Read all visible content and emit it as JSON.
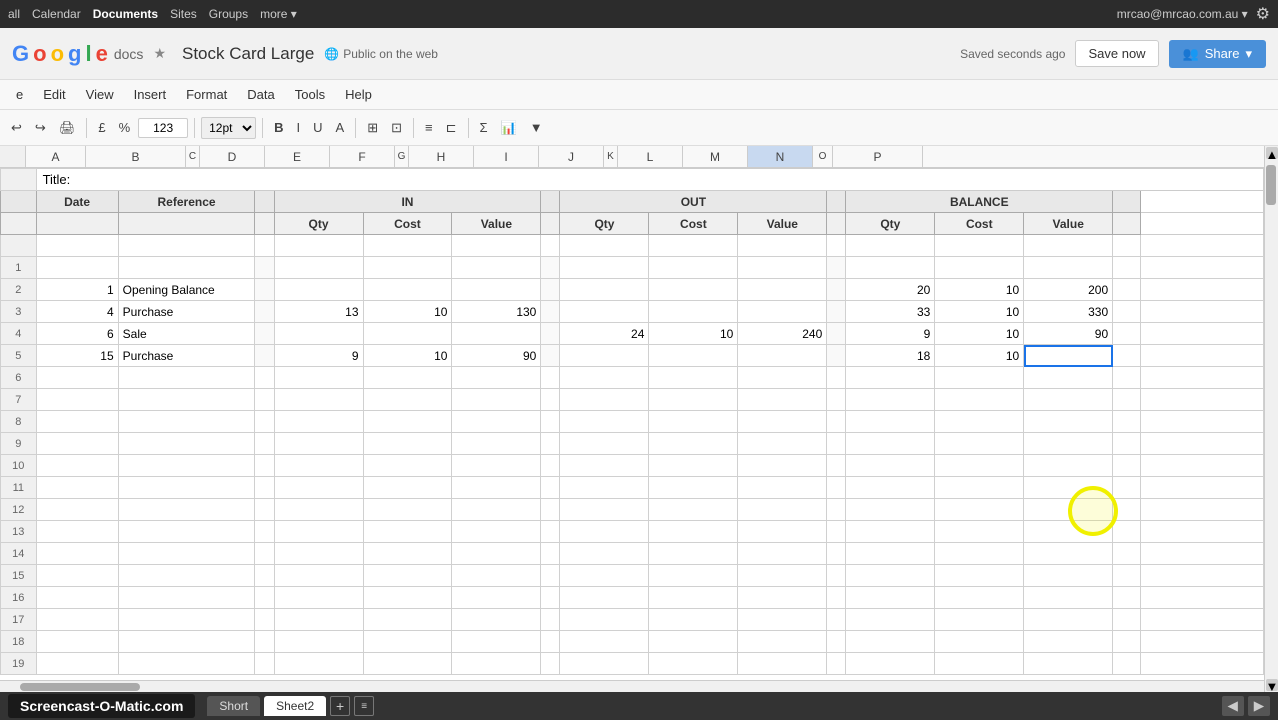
{
  "topBar": {
    "leftItems": [
      "all",
      "Calendar",
      "Documents",
      "Sites",
      "Groups",
      "more ▾"
    ],
    "rightText": "mrcao@mrcao.com.au ▾",
    "gearTitle": "Settings"
  },
  "appHeader": {
    "logoText": "Google docs",
    "starSymbol": "★",
    "docTitle": "Stock Card Large",
    "globeSymbol": "🌐",
    "publicLabel": "Public on the web",
    "savedText": "Saved seconds ago",
    "saveNowLabel": "Save now",
    "shareLabel": "Share",
    "shareDropdown": "▾"
  },
  "menuBar": {
    "items": [
      "e",
      "Edit",
      "View",
      "Insert",
      "Format",
      "Data",
      "Tools",
      "Help"
    ]
  },
  "toolbar": {
    "undoLabel": "↩",
    "redoLabel": "↪",
    "printLabel": "🖨",
    "percentLabel": "%",
    "currencyLabel": "£",
    "zoomValue": "123",
    "fontSizeValue": "12pt",
    "boldLabel": "B",
    "italicLabel": "I",
    "underlineLabel": "U",
    "fontColorLabel": "A",
    "bgColorLabel": "A",
    "bordersLabel": "⊞",
    "mergeLabel": "⊡",
    "alignLabel": "≡",
    "wrapLabel": "⊏",
    "clipLabel": "⊏",
    "formulaLabel": "Σ",
    "chartLabel": "📊",
    "filterLabel": "▼"
  },
  "columnHeaders": [
    "",
    "A",
    "B",
    "",
    "D",
    "E",
    "F",
    "",
    "H",
    "I",
    "J",
    "",
    "L",
    "M",
    "N",
    "O",
    "P"
  ],
  "spreadsheet": {
    "titleLabel": "Title:",
    "headers": {
      "dateLabel": "Date",
      "referenceLabel": "Reference",
      "inLabel": "IN",
      "outLabel": "OUT",
      "balanceLabel": "BALANCE",
      "qtyLabel": "Qty",
      "costLabel": "Cost",
      "valueLabel": "Value"
    },
    "rows": [
      {
        "date": "",
        "reference": "",
        "inQty": "",
        "inCost": "",
        "inValue": "",
        "outQty": "",
        "outCost": "",
        "outValue": "",
        "balQty": "",
        "balCost": "",
        "balValue": ""
      },
      {
        "date": "1",
        "reference": "Opening Balance",
        "inQty": "",
        "inCost": "",
        "inValue": "",
        "outQty": "",
        "outCost": "",
        "outValue": "",
        "balQty": "20",
        "balCost": "10",
        "balValue": "200"
      },
      {
        "date": "4",
        "reference": "Purchase",
        "inQty": "13",
        "inCost": "10",
        "inValue": "130",
        "outQty": "",
        "outCost": "",
        "outValue": "",
        "balQty": "33",
        "balCost": "10",
        "balValue": "330"
      },
      {
        "date": "6",
        "reference": "Sale",
        "inQty": "",
        "inCost": "",
        "inValue": "",
        "outQty": "24",
        "outCost": "10",
        "outValue": "240",
        "balQty": "9",
        "balCost": "10",
        "balValue": "90"
      },
      {
        "date": "15",
        "reference": "Purchase",
        "inQty": "9",
        "inCost": "10",
        "inValue": "90",
        "outQty": "",
        "outCost": "",
        "outValue": "",
        "balQty": "18",
        "balCost": "10",
        "balValue": ""
      }
    ]
  },
  "sheetTabs": {
    "sheets": [
      "Short",
      "Sheet2"
    ],
    "active": "Short"
  },
  "screencastBadge": "Screencast-O-Matic.com"
}
